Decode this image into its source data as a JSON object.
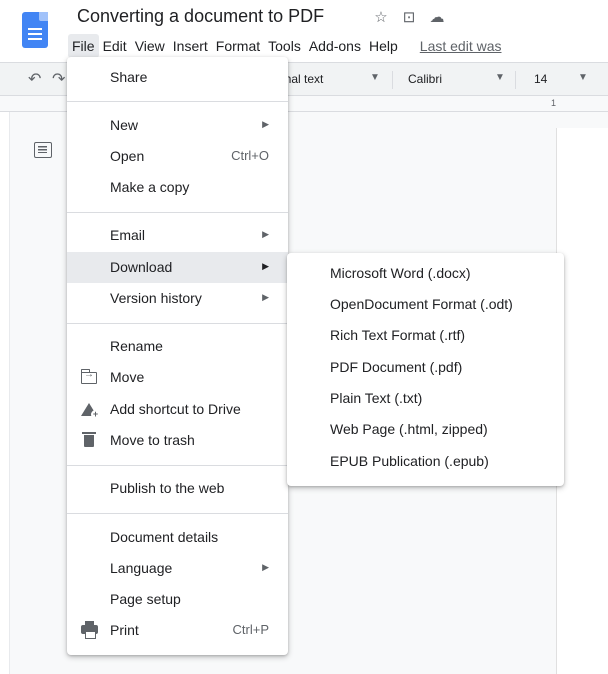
{
  "header": {
    "title": "Converting a document to PDF",
    "menu": [
      "File",
      "Edit",
      "View",
      "Insert",
      "Format",
      "Tools",
      "Add-ons",
      "Help"
    ],
    "last_edit": "Last edit was"
  },
  "toolbar": {
    "style": "Normal text",
    "font": "Calibri",
    "size": "14"
  },
  "ruler": {
    "marker": "1"
  },
  "file_menu": {
    "share": "Share",
    "new": "New",
    "open": "Open",
    "open_shortcut": "Ctrl+O",
    "make_copy": "Make a copy",
    "email": "Email",
    "download": "Download",
    "version_history": "Version history",
    "rename": "Rename",
    "move": "Move",
    "add_shortcut": "Add shortcut to Drive",
    "move_to_trash": "Move to trash",
    "publish": "Publish to the web",
    "document_details": "Document details",
    "language": "Language",
    "page_setup": "Page setup",
    "print": "Print",
    "print_shortcut": "Ctrl+P"
  },
  "download_menu": {
    "items": [
      "Microsoft Word (.docx)",
      "OpenDocument Format (.odt)",
      "Rich Text Format (.rtf)",
      "PDF Document (.pdf)",
      "Plain Text (.txt)",
      "Web Page (.html, zipped)",
      "EPUB Publication (.epub)"
    ]
  },
  "colors": {
    "docs_blue": "#4285f4",
    "menu_highlight": "#e8eaed",
    "text": "#202124",
    "muted": "#5f6368"
  }
}
